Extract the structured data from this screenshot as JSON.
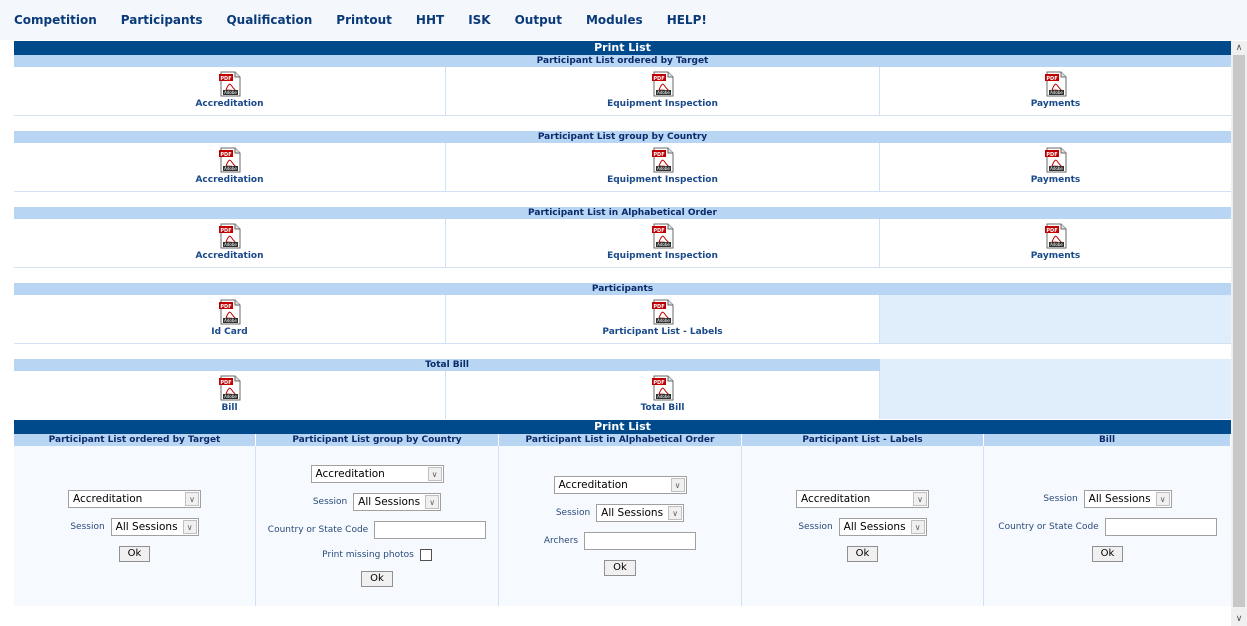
{
  "menu": [
    "Competition",
    "Participants",
    "Qualification",
    "Printout",
    "HHT",
    "ISK",
    "Output",
    "Modules",
    "HELP!"
  ],
  "print_list_title": "Print List",
  "pdf_icon_text": [
    "PDF",
    "Adobe"
  ],
  "sections": [
    {
      "heading": "Participant List ordered by Target",
      "items": [
        "Accreditation",
        "Equipment Inspection",
        "Payments"
      ]
    },
    {
      "heading": "Participant List group by Country",
      "items": [
        "Accreditation",
        "Equipment Inspection",
        "Payments"
      ]
    },
    {
      "heading": "Participant List in Alphabetical Order",
      "items": [
        "Accreditation",
        "Equipment Inspection",
        "Payments"
      ]
    },
    {
      "heading": "Participants",
      "items": [
        "Id Card",
        "Participant List - Labels"
      ]
    },
    {
      "heading": "Total Bill",
      "items": [
        "Bill",
        "Total Bill"
      ]
    }
  ],
  "form": {
    "title": "Print List",
    "headers": [
      "Participant List ordered by Target",
      "Participant List group by Country",
      "Participant List in Alphabetical Order",
      "Participant List - Labels",
      "Bill"
    ],
    "session_label": "Session",
    "session_value": "All Sessions",
    "report_value": "Accreditation",
    "country_label": "Country or State Code",
    "missing_photos_label": "Print missing photos",
    "archers_label": "Archers",
    "ok_label": "Ok"
  },
  "colors": {
    "title_bar": "#004a8c",
    "section_head": "#b8d6f4",
    "menu_text": "#0a3a7a"
  }
}
